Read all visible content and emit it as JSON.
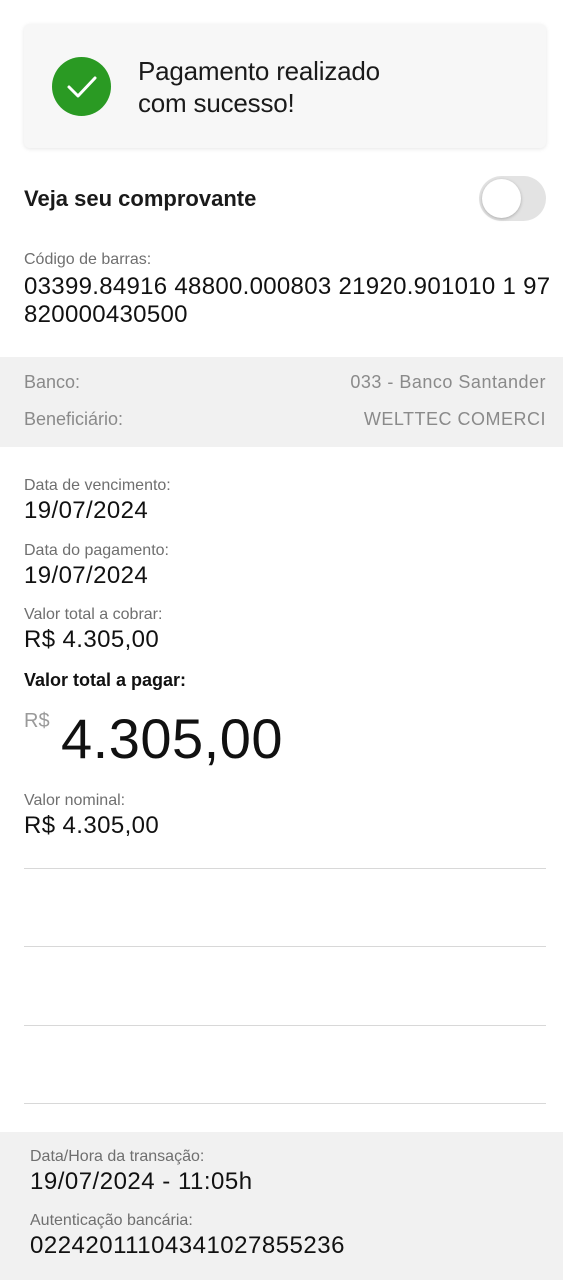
{
  "success": {
    "icon": "check-icon",
    "icon_color": "#2a9a23",
    "message": "Pagamento realizado\ncom sucesso!"
  },
  "receipt": {
    "label": "Veja seu comprovante",
    "toggle_on": false
  },
  "barcode": {
    "label": "Código de barras:",
    "value": "03399.84916 48800.000803 21920.901010 1 97820000430500"
  },
  "bank_info": {
    "bank_label": "Banco:",
    "bank_value": "033 - Banco Santander",
    "beneficiary_label": "Beneficiário:",
    "beneficiary_value": "WELTTEC COMERCI"
  },
  "details": {
    "due_date_label": "Data de vencimento:",
    "due_date_value": "19/07/2024",
    "payment_date_label": "Data do pagamento:",
    "payment_date_value": "19/07/2024",
    "total_charge_label": "Valor total a cobrar:",
    "total_charge_value": "R$  4.305,00",
    "total_pay_label": "Valor total a pagar:",
    "total_pay_currency": "R$",
    "total_pay_amount": "4.305,00",
    "nominal_label": "Valor nominal:",
    "nominal_value": "R$  4.305,00"
  },
  "footer": {
    "datetime_label": "Data/Hora da transação:",
    "datetime_value": "19/07/2024 - 11:05h",
    "auth_label": "Autenticação bancária:",
    "auth_value": "02242011104341027855236"
  }
}
